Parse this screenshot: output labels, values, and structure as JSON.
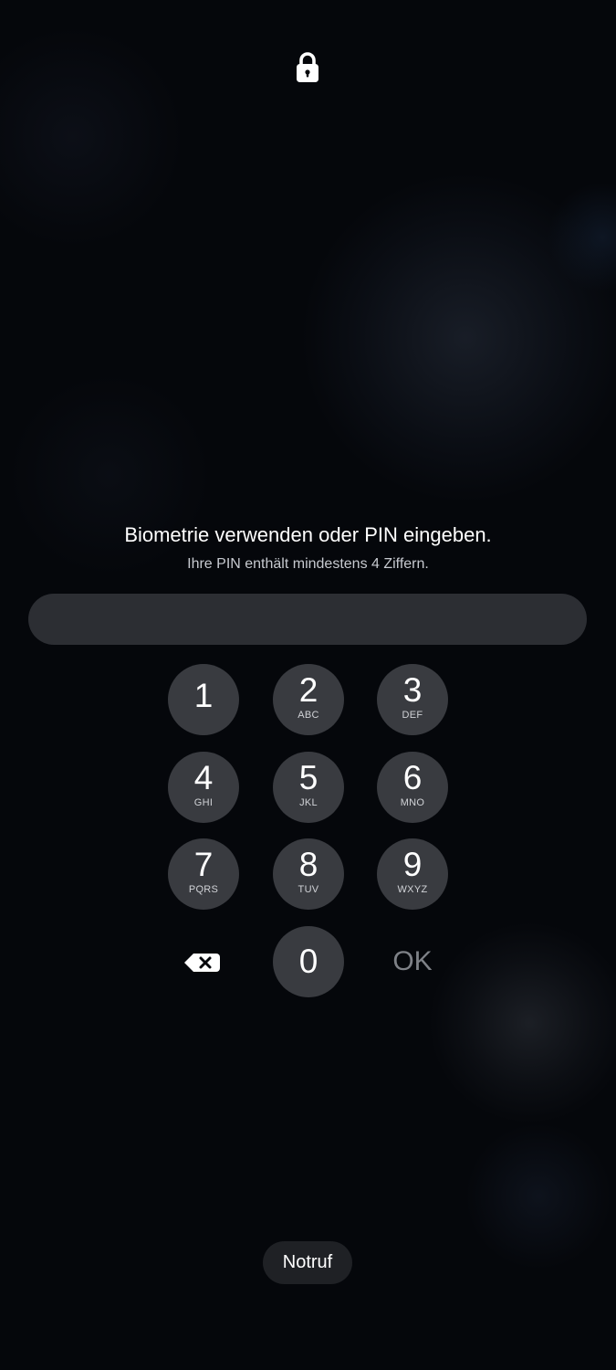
{
  "header": {
    "lock_icon": "lock-icon"
  },
  "prompt": {
    "title": "Biometrie verwenden oder PIN eingeben.",
    "subtitle": "Ihre PIN enthält mindestens 4 Ziffern."
  },
  "pin": {
    "value": "",
    "placeholder": ""
  },
  "keypad": {
    "keys": [
      {
        "digit": "1",
        "letters": ""
      },
      {
        "digit": "2",
        "letters": "ABC"
      },
      {
        "digit": "3",
        "letters": "DEF"
      },
      {
        "digit": "4",
        "letters": "GHI"
      },
      {
        "digit": "5",
        "letters": "JKL"
      },
      {
        "digit": "6",
        "letters": "MNO"
      },
      {
        "digit": "7",
        "letters": "PQRS"
      },
      {
        "digit": "8",
        "letters": "TUV"
      },
      {
        "digit": "9",
        "letters": "WXYZ"
      },
      {
        "digit": "0",
        "letters": ""
      }
    ],
    "backspace_icon": "backspace-icon",
    "ok_label": "OK"
  },
  "footer": {
    "emergency_label": "Notruf"
  },
  "colors": {
    "background": "#05070b",
    "key_fill": "#393b40",
    "pin_field": "#2c2e33",
    "ok_disabled": "#7e8187"
  }
}
